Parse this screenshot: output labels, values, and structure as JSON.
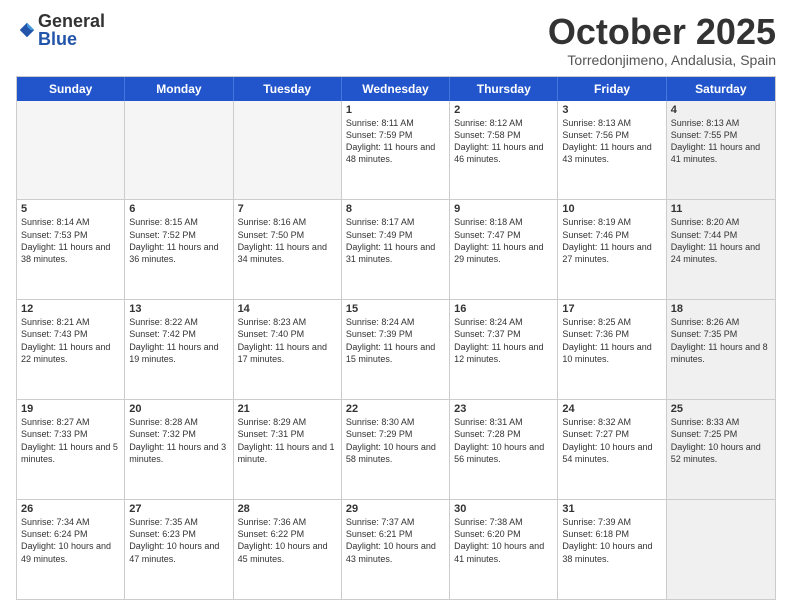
{
  "logo": {
    "general": "General",
    "blue": "Blue"
  },
  "title": "October 2025",
  "location": "Torredonjimeno, Andalusia, Spain",
  "weekdays": [
    "Sunday",
    "Monday",
    "Tuesday",
    "Wednesday",
    "Thursday",
    "Friday",
    "Saturday"
  ],
  "rows": [
    [
      {
        "day": "",
        "text": "",
        "empty": true
      },
      {
        "day": "",
        "text": "",
        "empty": true
      },
      {
        "day": "",
        "text": "",
        "empty": true
      },
      {
        "day": "1",
        "text": "Sunrise: 8:11 AM\nSunset: 7:59 PM\nDaylight: 11 hours\nand 48 minutes."
      },
      {
        "day": "2",
        "text": "Sunrise: 8:12 AM\nSunset: 7:58 PM\nDaylight: 11 hours\nand 46 minutes."
      },
      {
        "day": "3",
        "text": "Sunrise: 8:13 AM\nSunset: 7:56 PM\nDaylight: 11 hours\nand 43 minutes."
      },
      {
        "day": "4",
        "text": "Sunrise: 8:13 AM\nSunset: 7:55 PM\nDaylight: 11 hours\nand 41 minutes.",
        "shaded": true
      }
    ],
    [
      {
        "day": "5",
        "text": "Sunrise: 8:14 AM\nSunset: 7:53 PM\nDaylight: 11 hours\nand 38 minutes."
      },
      {
        "day": "6",
        "text": "Sunrise: 8:15 AM\nSunset: 7:52 PM\nDaylight: 11 hours\nand 36 minutes."
      },
      {
        "day": "7",
        "text": "Sunrise: 8:16 AM\nSunset: 7:50 PM\nDaylight: 11 hours\nand 34 minutes."
      },
      {
        "day": "8",
        "text": "Sunrise: 8:17 AM\nSunset: 7:49 PM\nDaylight: 11 hours\nand 31 minutes."
      },
      {
        "day": "9",
        "text": "Sunrise: 8:18 AM\nSunset: 7:47 PM\nDaylight: 11 hours\nand 29 minutes."
      },
      {
        "day": "10",
        "text": "Sunrise: 8:19 AM\nSunset: 7:46 PM\nDaylight: 11 hours\nand 27 minutes."
      },
      {
        "day": "11",
        "text": "Sunrise: 8:20 AM\nSunset: 7:44 PM\nDaylight: 11 hours\nand 24 minutes.",
        "shaded": true
      }
    ],
    [
      {
        "day": "12",
        "text": "Sunrise: 8:21 AM\nSunset: 7:43 PM\nDaylight: 11 hours\nand 22 minutes."
      },
      {
        "day": "13",
        "text": "Sunrise: 8:22 AM\nSunset: 7:42 PM\nDaylight: 11 hours\nand 19 minutes."
      },
      {
        "day": "14",
        "text": "Sunrise: 8:23 AM\nSunset: 7:40 PM\nDaylight: 11 hours\nand 17 minutes."
      },
      {
        "day": "15",
        "text": "Sunrise: 8:24 AM\nSunset: 7:39 PM\nDaylight: 11 hours\nand 15 minutes."
      },
      {
        "day": "16",
        "text": "Sunrise: 8:24 AM\nSunset: 7:37 PM\nDaylight: 11 hours\nand 12 minutes."
      },
      {
        "day": "17",
        "text": "Sunrise: 8:25 AM\nSunset: 7:36 PM\nDaylight: 11 hours\nand 10 minutes."
      },
      {
        "day": "18",
        "text": "Sunrise: 8:26 AM\nSunset: 7:35 PM\nDaylight: 11 hours\nand 8 minutes.",
        "shaded": true
      }
    ],
    [
      {
        "day": "19",
        "text": "Sunrise: 8:27 AM\nSunset: 7:33 PM\nDaylight: 11 hours\nand 5 minutes."
      },
      {
        "day": "20",
        "text": "Sunrise: 8:28 AM\nSunset: 7:32 PM\nDaylight: 11 hours\nand 3 minutes."
      },
      {
        "day": "21",
        "text": "Sunrise: 8:29 AM\nSunset: 7:31 PM\nDaylight: 11 hours\nand 1 minute."
      },
      {
        "day": "22",
        "text": "Sunrise: 8:30 AM\nSunset: 7:29 PM\nDaylight: 10 hours\nand 58 minutes."
      },
      {
        "day": "23",
        "text": "Sunrise: 8:31 AM\nSunset: 7:28 PM\nDaylight: 10 hours\nand 56 minutes."
      },
      {
        "day": "24",
        "text": "Sunrise: 8:32 AM\nSunset: 7:27 PM\nDaylight: 10 hours\nand 54 minutes."
      },
      {
        "day": "25",
        "text": "Sunrise: 8:33 AM\nSunset: 7:25 PM\nDaylight: 10 hours\nand 52 minutes.",
        "shaded": true
      }
    ],
    [
      {
        "day": "26",
        "text": "Sunrise: 7:34 AM\nSunset: 6:24 PM\nDaylight: 10 hours\nand 49 minutes."
      },
      {
        "day": "27",
        "text": "Sunrise: 7:35 AM\nSunset: 6:23 PM\nDaylight: 10 hours\nand 47 minutes."
      },
      {
        "day": "28",
        "text": "Sunrise: 7:36 AM\nSunset: 6:22 PM\nDaylight: 10 hours\nand 45 minutes."
      },
      {
        "day": "29",
        "text": "Sunrise: 7:37 AM\nSunset: 6:21 PM\nDaylight: 10 hours\nand 43 minutes."
      },
      {
        "day": "30",
        "text": "Sunrise: 7:38 AM\nSunset: 6:20 PM\nDaylight: 10 hours\nand 41 minutes."
      },
      {
        "day": "31",
        "text": "Sunrise: 7:39 AM\nSunset: 6:18 PM\nDaylight: 10 hours\nand 38 minutes."
      },
      {
        "day": "",
        "text": "",
        "empty": true,
        "shaded": true
      }
    ]
  ]
}
